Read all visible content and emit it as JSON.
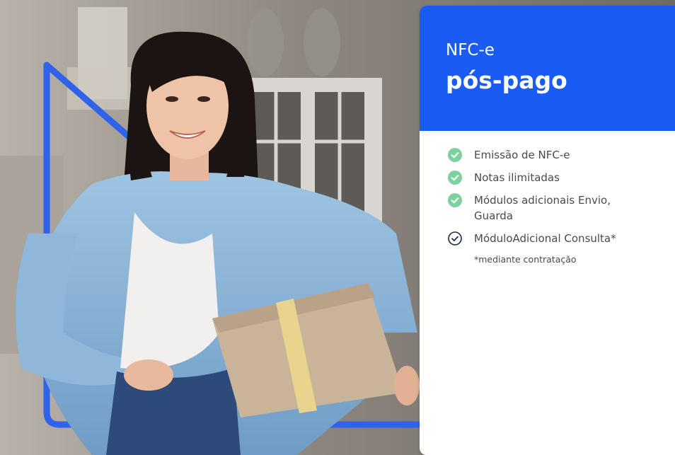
{
  "card": {
    "subtitle": "NFC-e",
    "title": "pós-pago",
    "features": [
      {
        "label": "Emissão de NFC-e",
        "icon": "check-circle-filled-icon"
      },
      {
        "label": "Notas ilimitadas",
        "icon": "check-circle-filled-icon"
      },
      {
        "label": "Módulos adicionais Envio, Guarda",
        "icon": "check-circle-filled-icon"
      },
      {
        "label": "MóduloAdicional Consulta*",
        "icon": "check-circle-outline-icon"
      }
    ],
    "note": "*mediante contratação"
  },
  "colors": {
    "header_bg": "#1a5cf3",
    "frame_blue": "#2f63ea",
    "check_green": "#7ed19e",
    "outline_check": "#1d2b4f"
  }
}
